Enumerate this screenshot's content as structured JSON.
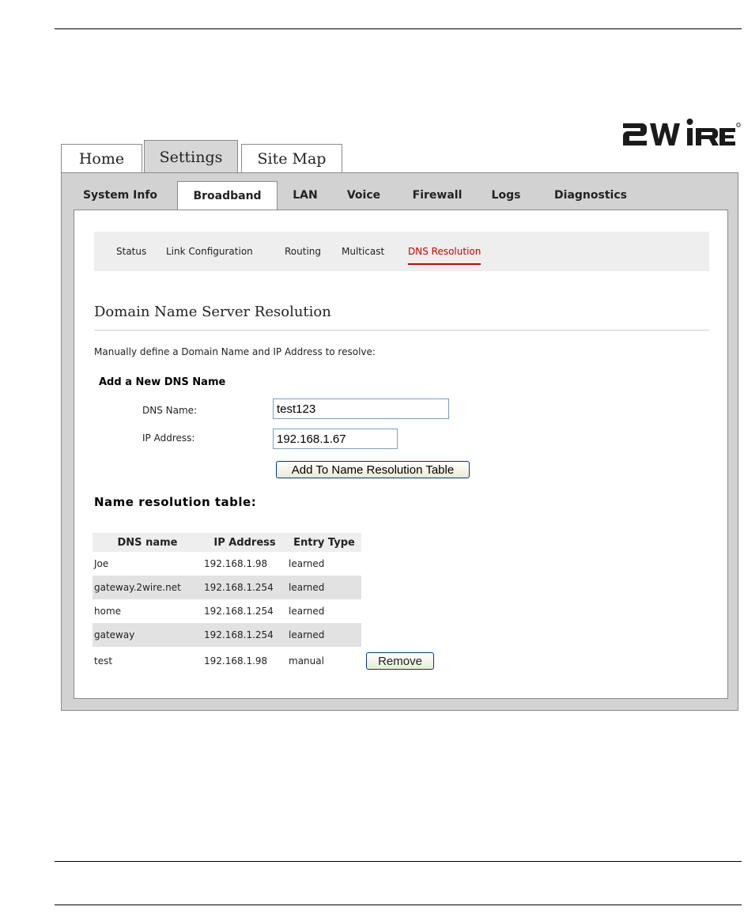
{
  "brand": {
    "logo_text": "2WIRE"
  },
  "top_tabs": [
    {
      "label": "Home"
    },
    {
      "label": "Settings"
    },
    {
      "label": "Site Map"
    }
  ],
  "sub_tabs": [
    {
      "label": "System Info"
    },
    {
      "label": "Broadband"
    },
    {
      "label": "LAN"
    },
    {
      "label": "Voice"
    },
    {
      "label": "Firewall"
    },
    {
      "label": "Logs"
    },
    {
      "label": "Diagnostics"
    }
  ],
  "section_nav": [
    {
      "label": "Status"
    },
    {
      "label": "Link Configuration"
    },
    {
      "label": "Routing"
    },
    {
      "label": "Multicast"
    },
    {
      "label": "DNS Resolution"
    }
  ],
  "page": {
    "title": "Domain Name Server Resolution",
    "description": "Manually define a Domain Name and IP Address to resolve:"
  },
  "add_form": {
    "title": "Add a New DNS Name",
    "dns_name_label": "DNS Name:",
    "dns_name_value": "test123",
    "ip_label": "IP Address:",
    "ip_value": "192.168.1.67",
    "submit_label": "Add To Name Resolution Table"
  },
  "table": {
    "title": "Name resolution table:",
    "headers": [
      "DNS name",
      "IP Address",
      "Entry Type"
    ],
    "rows": [
      {
        "name": "Joe",
        "ip": "192.168.1.98",
        "type": "learned"
      },
      {
        "name": "gateway.2wire.net",
        "ip": "192.168.1.254",
        "type": "learned"
      },
      {
        "name": "home",
        "ip": "192.168.1.254",
        "type": "learned"
      },
      {
        "name": "gateway",
        "ip": "192.168.1.254",
        "type": "learned"
      },
      {
        "name": "test",
        "ip": "192.168.1.98",
        "type": "manual",
        "action": "Remove"
      }
    ]
  }
}
